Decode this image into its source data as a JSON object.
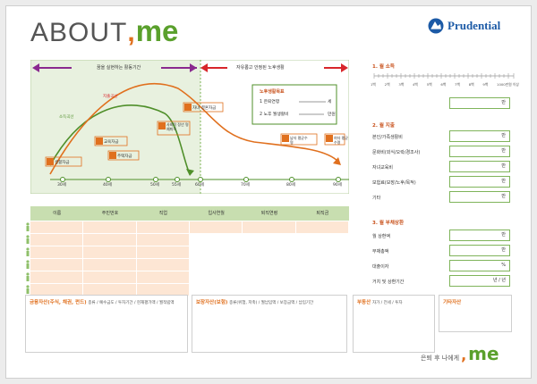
{
  "header": {
    "title_about": "ABOUT",
    "title_comma": ",",
    "title_me": "me",
    "brand": "Prudential"
  },
  "timeline": {
    "active_period": "꿈을 실현하는 활동기간",
    "retire_period": "자유롭고 안정된 노후생활",
    "goal_title": "노후생활목표",
    "goal_item1": "1 은퇴연령",
    "goal_item1_unit": "세",
    "goal_item2": "2 노후 월생활비",
    "goal_item2_unit": "만원",
    "curve_spend": "지출곡선",
    "curve_income": "소득곡선",
    "events": [
      "생활자금",
      "교육자금",
      "주택자금",
      "사회적 정년 명예퇴직",
      "자녀 결혼자금",
      "남자 평균수명",
      "여자 평균수명"
    ],
    "ages": [
      "30세",
      "40세",
      "50세",
      "55세",
      "60세",
      "70세",
      "80세",
      "90세"
    ]
  },
  "table": {
    "headers": [
      "이름",
      "주민번호",
      "직업",
      "입사연월",
      "퇴직연령",
      "퇴직금"
    ]
  },
  "right": {
    "income": {
      "title": "1. 월 소득",
      "ticks": [
        "1백",
        "2백",
        "3백",
        "4백",
        "5백",
        "6백",
        "7백",
        "8백",
        "9백",
        "1000만원 이상"
      ],
      "unit": "만"
    },
    "expense": {
      "title": "2. 월 지출",
      "items": [
        "본인/가족생활비",
        "문화비(외식/오락/경조사)",
        "자녀교육비",
        "보험료(보장/노후/목적)",
        "기타"
      ],
      "unit": "만"
    },
    "debt": {
      "title": "3. 월 부채상환",
      "items": [
        "월 상환액",
        "부채총액",
        "대출이자",
        "거치 및 상환기간"
      ],
      "units": [
        "만",
        "만",
        "%",
        "년 / 년"
      ]
    }
  },
  "boxes": {
    "financial_title": "금융자산(주식, 채권, 펀드)",
    "financial_sub": "종류 / 예수금도 / 투자기간 / 현재평가액 / 월적립액",
    "insurance_title": "보장자산(보험)",
    "insurance_sub": "종류(위험, 저축) / 월납입액 / 보장금액 / 납입기간",
    "realestate_title": "부동산",
    "realestate_sub": "자가 / 전세 / 투자",
    "other_title": "기타자산"
  },
  "footer": {
    "text": "은퇴 후 나에게",
    "comma": ",",
    "me": "me"
  },
  "colors": {
    "purple": "#8a2a8f",
    "red": "#d8262b",
    "orange": "#e0701e",
    "green": "#4f8f2a",
    "light_green": "#c8deb0",
    "peach": "#fde6d4"
  }
}
